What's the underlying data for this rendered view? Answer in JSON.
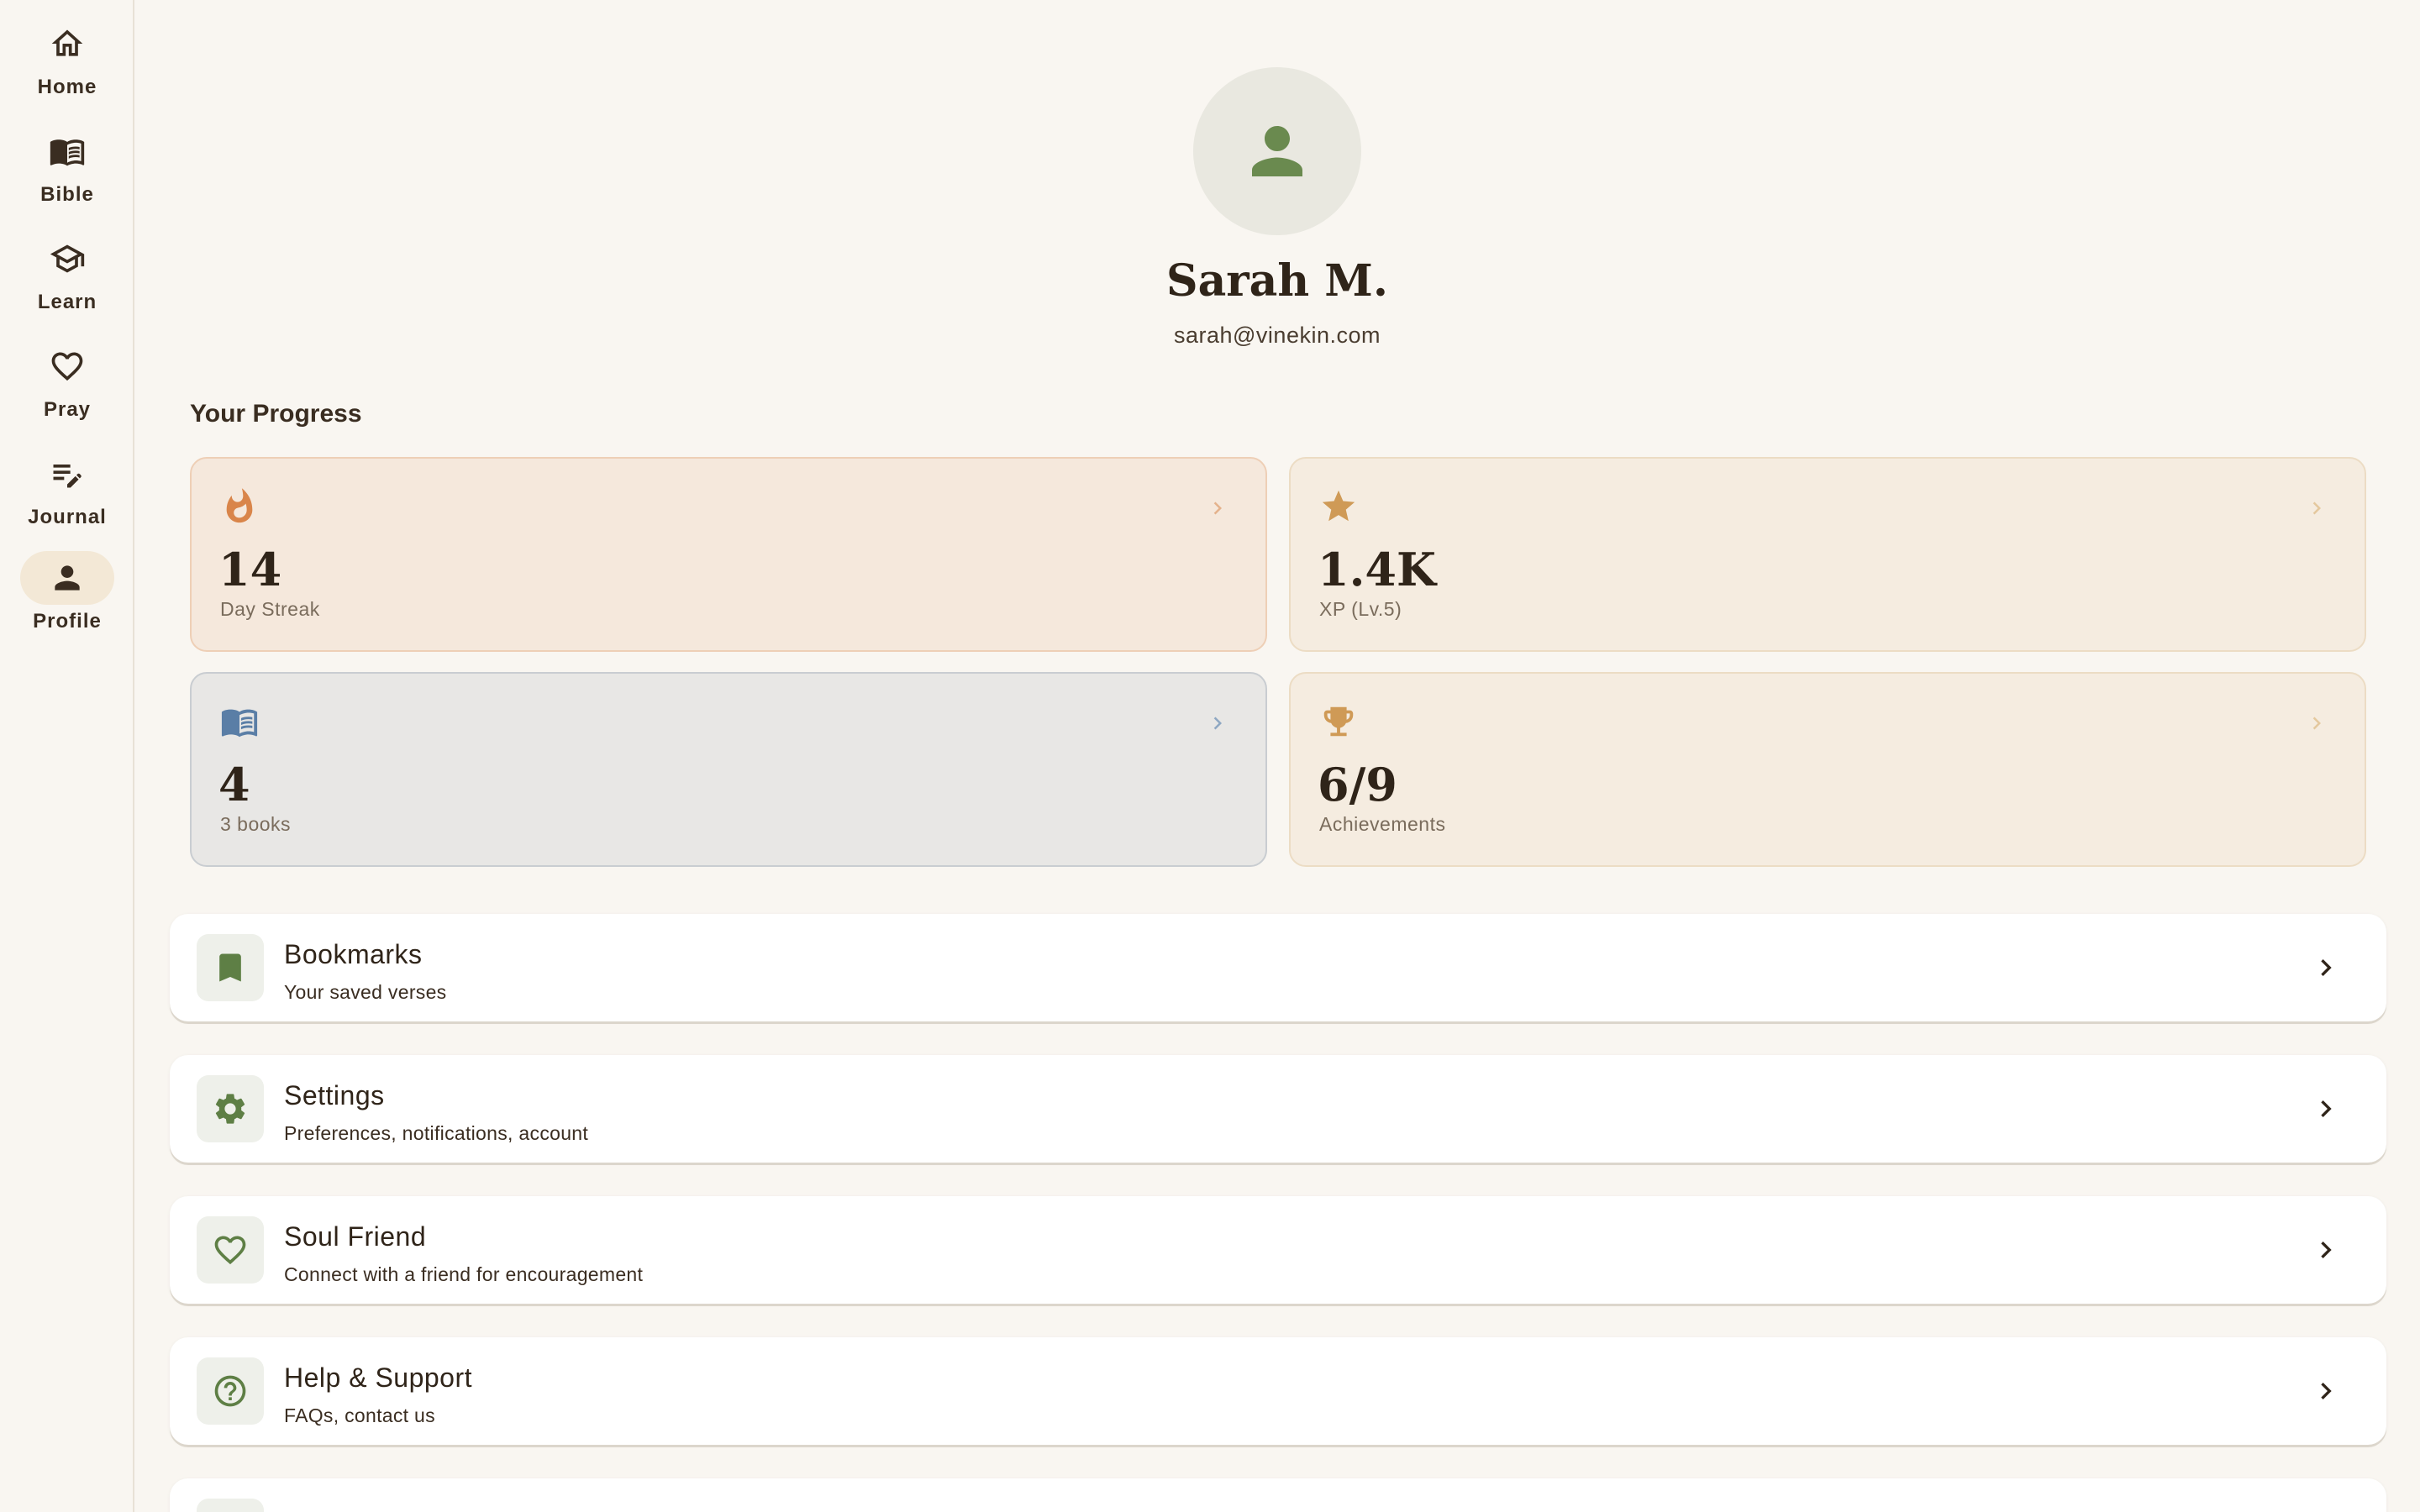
{
  "nav": {
    "items": [
      {
        "label": "Home",
        "icon": "home-icon"
      },
      {
        "label": "Bible",
        "icon": "book-icon"
      },
      {
        "label": "Learn",
        "icon": "graduation-cap-icon"
      },
      {
        "label": "Pray",
        "icon": "heart-icon"
      },
      {
        "label": "Journal",
        "icon": "edit-note-icon"
      },
      {
        "label": "Profile",
        "icon": "person-icon",
        "active": true
      }
    ]
  },
  "profile": {
    "name": "Sarah M.",
    "email": "sarah@vinekin.com"
  },
  "progress": {
    "title": "Your Progress",
    "cards": [
      {
        "value": "14",
        "label": "Day Streak",
        "icon": "flame-icon",
        "color": "#d9854a"
      },
      {
        "value": "1.4K",
        "label": "XP (Lv.5)",
        "icon": "star-icon",
        "color": "#cf9a56"
      },
      {
        "value": "4",
        "label": "3 books",
        "icon": "book-open-icon",
        "color": "#5a7ea6"
      },
      {
        "value": "6/9",
        "label": "Achievements",
        "icon": "trophy-icon",
        "color": "#cf9a56"
      }
    ]
  },
  "menu": [
    {
      "title": "Bookmarks",
      "subtitle": "Your saved verses",
      "icon": "bookmark-icon"
    },
    {
      "title": "Settings",
      "subtitle": "Preferences, notifications, account",
      "icon": "gear-icon"
    },
    {
      "title": "Soul Friend",
      "subtitle": "Connect with a friend for encouragement",
      "icon": "heart-icon"
    },
    {
      "title": "Help & Support",
      "subtitle": "FAQs, contact us",
      "icon": "help-circle-icon"
    }
  ],
  "colors": {
    "background": "#f9f6f1",
    "accent_green": "#5e7f45",
    "text_dark": "#2f2419"
  }
}
